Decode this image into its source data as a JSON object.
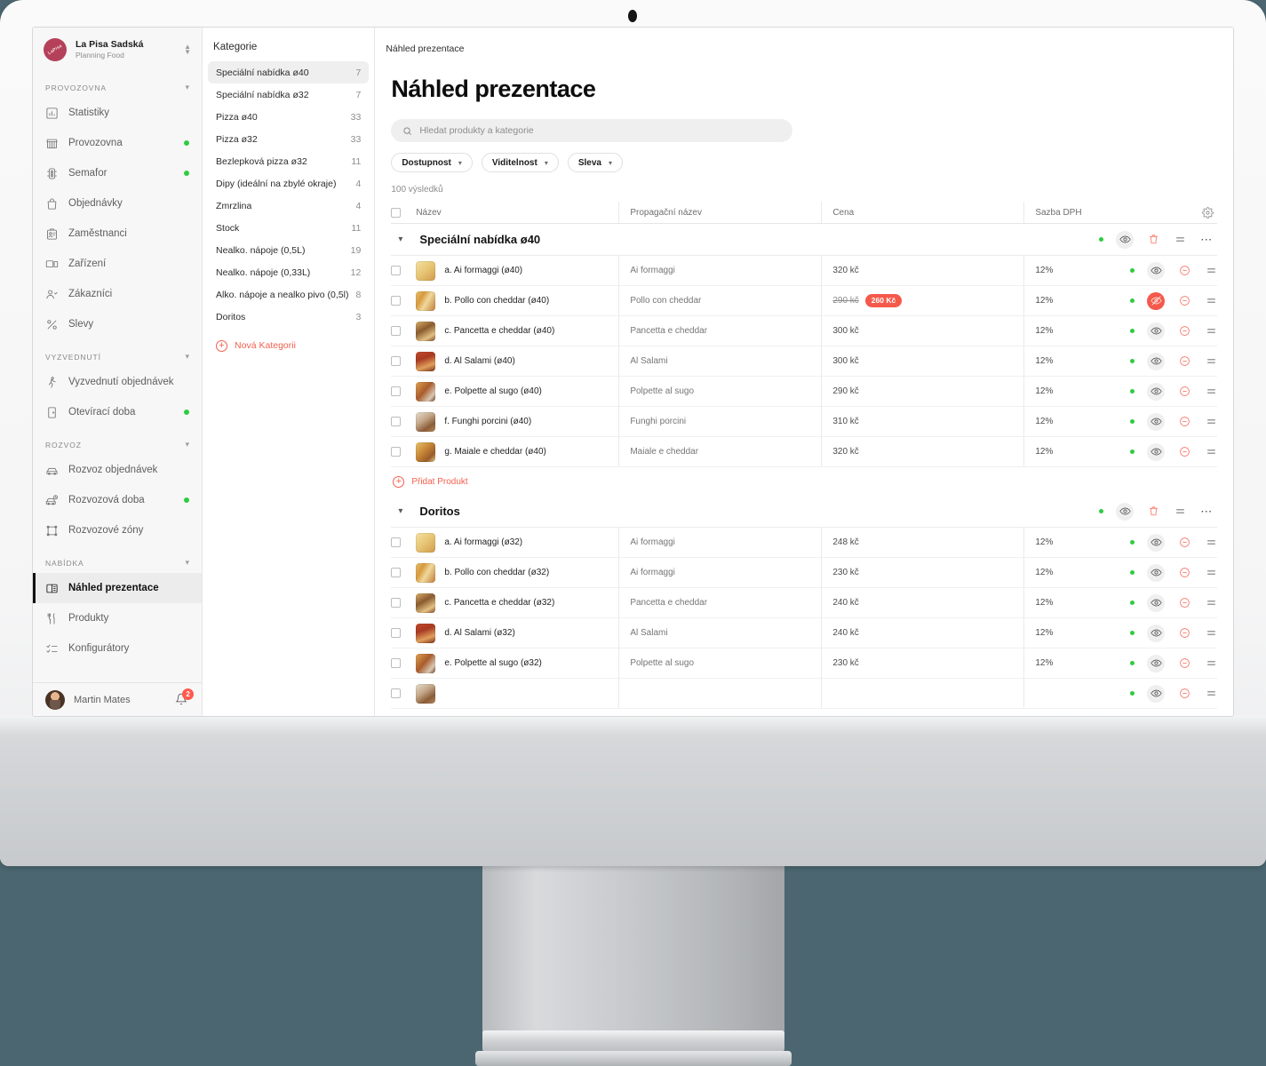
{
  "brand": {
    "name": "La Pisa Sadská",
    "subtitle": "Planning Food",
    "logo_text": "LaPisa",
    "logo_color": "#b5405a"
  },
  "sidebar": {
    "sections": [
      {
        "label": "PROVOZOVNA",
        "items": [
          {
            "label": "Statistiky",
            "icon": "chart-icon",
            "dot": false,
            "active": false
          },
          {
            "label": "Provozovna",
            "icon": "store-icon",
            "dot": true,
            "active": false
          },
          {
            "label": "Semafor",
            "icon": "traffic-light-icon",
            "dot": true,
            "active": false
          },
          {
            "label": "Objednávky",
            "icon": "bag-icon",
            "dot": false,
            "active": false
          },
          {
            "label": "Zaměstnanci",
            "icon": "badge-icon",
            "dot": false,
            "active": false
          },
          {
            "label": "Zařízení",
            "icon": "device-icon",
            "dot": false,
            "active": false
          },
          {
            "label": "Zákazníci",
            "icon": "users-icon",
            "dot": false,
            "active": false
          },
          {
            "label": "Slevy",
            "icon": "percent-icon",
            "dot": false,
            "active": false
          }
        ]
      },
      {
        "label": "VYZVEDNUTÍ",
        "items": [
          {
            "label": "Vyzvednutí objednávek",
            "icon": "walking-icon",
            "dot": false,
            "active": false
          },
          {
            "label": "Otevírací doba",
            "icon": "door-icon",
            "dot": true,
            "active": false
          }
        ]
      },
      {
        "label": "ROZVOZ",
        "items": [
          {
            "label": "Rozvoz objednávek",
            "icon": "car-icon",
            "dot": false,
            "active": false
          },
          {
            "label": "Rozvozová doba",
            "icon": "car-clock-icon",
            "dot": true,
            "active": false
          },
          {
            "label": "Rozvozové zóny",
            "icon": "zone-icon",
            "dot": false,
            "active": false
          }
        ]
      },
      {
        "label": "NABÍDKA",
        "items": [
          {
            "label": "Náhled prezentace",
            "icon": "book-icon",
            "dot": false,
            "active": true
          },
          {
            "label": "Produkty",
            "icon": "cutlery-icon",
            "dot": false,
            "active": false
          },
          {
            "label": "Konfigurátory",
            "icon": "checklist-icon",
            "dot": false,
            "active": false
          }
        ]
      }
    ],
    "user": {
      "name": "Martin Mates",
      "notifications": "2"
    }
  },
  "categories": {
    "title": "Kategorie",
    "items": [
      {
        "name": "Speciální nabídka ø40",
        "count": "7",
        "selected": true
      },
      {
        "name": "Speciální nabídka ø32",
        "count": "7",
        "selected": false
      },
      {
        "name": "Pizza ø40",
        "count": "33",
        "selected": false
      },
      {
        "name": "Pizza ø32",
        "count": "33",
        "selected": false
      },
      {
        "name": "Bezlepková pizza ø32",
        "count": "11",
        "selected": false
      },
      {
        "name": "Dipy (ideální na zbylé okraje)",
        "count": "4",
        "selected": false
      },
      {
        "name": "Zmrzlina",
        "count": "4",
        "selected": false
      },
      {
        "name": "Stock",
        "count": "11",
        "selected": false
      },
      {
        "name": "Nealko. nápoje (0,5L)",
        "count": "19",
        "selected": false
      },
      {
        "name": "Nealko. nápoje (0,33L)",
        "count": "12",
        "selected": false
      },
      {
        "name": "Alko. nápoje a nealko pivo (0,5l)",
        "count": "8",
        "selected": false
      },
      {
        "name": "Doritos",
        "count": "3",
        "selected": false
      }
    ],
    "new_category_label": "Nová Kategorii"
  },
  "main": {
    "breadcrumb": "Náhled prezentace",
    "page_title": "Náhled prezentace",
    "search_placeholder": "Hledat produkty a kategorie",
    "search_value": "",
    "filters": [
      {
        "label": "Dostupnost"
      },
      {
        "label": "Viditelnost"
      },
      {
        "label": "Sleva"
      }
    ],
    "results_count": "100 výsledků",
    "columns": {
      "name": "Název",
      "promo": "Propagační název",
      "price": "Cena",
      "vat": "Sazba DPH"
    },
    "add_product_label": "Přidat Produkt",
    "groups": [
      {
        "name": "Speciální nabídka ø40",
        "visible": true,
        "rows": [
          {
            "name": "a. Ai formaggi (ø40)",
            "promo": "Ai formaggi",
            "price": "320 kč",
            "old_price": "",
            "discount": "",
            "vat": "12%",
            "available": true,
            "hidden": false,
            "thumb": "t1"
          },
          {
            "name": "b. Pollo con cheddar (ø40)",
            "promo": "Pollo con cheddar",
            "price": "",
            "old_price": "290 kč",
            "discount": "260 Kč",
            "vat": "12%",
            "available": true,
            "hidden": true,
            "thumb": "t2"
          },
          {
            "name": "c. Pancetta e cheddar (ø40)",
            "promo": "Pancetta e cheddar",
            "price": "300 kč",
            "old_price": "",
            "discount": "",
            "vat": "12%",
            "available": true,
            "hidden": false,
            "thumb": "t3"
          },
          {
            "name": "d. Al Salami (ø40)",
            "promo": "Al Salami",
            "price": "300 kč",
            "old_price": "",
            "discount": "",
            "vat": "12%",
            "available": true,
            "hidden": false,
            "thumb": "t4"
          },
          {
            "name": "e. Polpette al sugo (ø40)",
            "promo": "Polpette al sugo",
            "price": "290 kč",
            "old_price": "",
            "discount": "",
            "vat": "12%",
            "available": true,
            "hidden": false,
            "thumb": "t5"
          },
          {
            "name": "f. Funghi porcini (ø40)",
            "promo": "Funghi porcini",
            "price": "310 kč",
            "old_price": "",
            "discount": "",
            "vat": "12%",
            "available": true,
            "hidden": false,
            "thumb": "t6"
          },
          {
            "name": "g. Maiale e cheddar (ø40)",
            "promo": "Maiale e cheddar",
            "price": "320 kč",
            "old_price": "",
            "discount": "",
            "vat": "12%",
            "available": true,
            "hidden": false,
            "thumb": "t7"
          }
        ]
      },
      {
        "name": "Doritos",
        "visible": true,
        "rows": [
          {
            "name": "a. Ai formaggi (ø32)",
            "promo": "Ai formaggi",
            "price": "248 kč",
            "old_price": "",
            "discount": "",
            "vat": "12%",
            "available": true,
            "hidden": false,
            "thumb": "t1"
          },
          {
            "name": "b. Pollo con cheddar (ø32)",
            "promo": "Ai formaggi",
            "price": "230 kč",
            "old_price": "",
            "discount": "",
            "vat": "12%",
            "available": true,
            "hidden": false,
            "thumb": "t2"
          },
          {
            "name": "c. Pancetta e cheddar (ø32)",
            "promo": "Pancetta e cheddar",
            "price": "240 kč",
            "old_price": "",
            "discount": "",
            "vat": "12%",
            "available": true,
            "hidden": false,
            "thumb": "t3"
          },
          {
            "name": "d. Al Salami (ø32)",
            "promo": "Al Salami",
            "price": "240 kč",
            "old_price": "",
            "discount": "",
            "vat": "12%",
            "available": true,
            "hidden": false,
            "thumb": "t4"
          },
          {
            "name": "e. Polpette al sugo (ø32)",
            "promo": "Polpette al sugo",
            "price": "230 kč",
            "old_price": "",
            "discount": "",
            "vat": "12%",
            "available": true,
            "hidden": false,
            "thumb": "t5"
          },
          {
            "name": "",
            "promo": "",
            "price": "",
            "old_price": "",
            "discount": "",
            "vat": "",
            "available": true,
            "hidden": false,
            "thumb": "t6"
          }
        ]
      }
    ]
  },
  "colors": {
    "accent_red": "#f5594b",
    "status_green": "#2ecc40",
    "background": "#4b6670"
  }
}
